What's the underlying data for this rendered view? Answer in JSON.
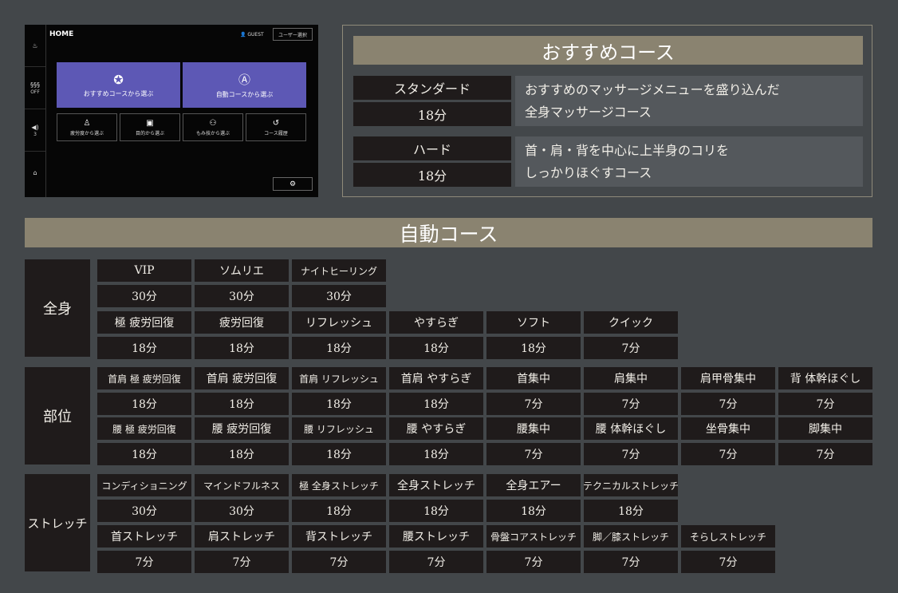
{
  "device": {
    "home_label": "HOME",
    "guest_label": "GUEST",
    "user_select_label": "ユーザー選択",
    "side": [
      {
        "icon": "massage-chair-icon",
        "glyph": "♨",
        "sub": ""
      },
      {
        "icon": "heat-icon",
        "glyph": "§§§",
        "sub": "OFF"
      },
      {
        "icon": "volume-icon",
        "glyph": "◀)",
        "sub": "3"
      },
      {
        "icon": "home-icon",
        "glyph": "⌂",
        "sub": ""
      }
    ],
    "big_buttons": [
      {
        "icon": "award-icon",
        "glyph": "✪",
        "label": "おすすめコースから選ぶ"
      },
      {
        "icon": "auto-icon",
        "glyph": "Ⓐ",
        "label": "自動コースから選ぶ"
      }
    ],
    "small_buttons": [
      {
        "icon": "body-icon",
        "glyph": "♙",
        "label": "疲労度から選ぶ"
      },
      {
        "icon": "target-icon",
        "glyph": "▣",
        "label": "目的から選ぶ"
      },
      {
        "icon": "massage-icon",
        "glyph": "⚇",
        "label": "もみ技から選ぶ"
      },
      {
        "icon": "history-icon",
        "glyph": "↺",
        "label": "コース履歴"
      }
    ],
    "settings_glyph": "⚙"
  },
  "recommended": {
    "title": "おすすめコース",
    "courses": [
      {
        "name": "スタンダード",
        "time": "18分",
        "desc1": "おすすめのマッサージメニューを盛り込んだ",
        "desc2": "全身マッサージコース"
      },
      {
        "name": "ハード",
        "time": "18分",
        "desc1": "首・肩・背を中心に上半身のコリを",
        "desc2": "しっかりほぐすコース"
      }
    ]
  },
  "auto": {
    "title": "自動コース",
    "categories": [
      {
        "name": "全身",
        "rows": [
          [
            {
              "name": "VIP",
              "time": "30分"
            },
            {
              "name": "ソムリエ",
              "time": "30分"
            },
            {
              "name": "ナイトヒーリング",
              "time": "30分"
            }
          ],
          [
            {
              "name": "極 疲労回復",
              "time": "18分"
            },
            {
              "name": "疲労回復",
              "time": "18分"
            },
            {
              "name": "リフレッシュ",
              "time": "18分"
            },
            {
              "name": "やすらぎ",
              "time": "18分"
            },
            {
              "name": "ソフト",
              "time": "18分"
            },
            {
              "name": "クイック",
              "time": "7分"
            }
          ]
        ]
      },
      {
        "name": "部位",
        "rows": [
          [
            {
              "name": "首肩 極 疲労回復",
              "time": "18分"
            },
            {
              "name": "首肩 疲労回復",
              "time": "18分"
            },
            {
              "name": "首肩 リフレッシュ",
              "time": "18分"
            },
            {
              "name": "首肩 やすらぎ",
              "time": "18分"
            },
            {
              "name": "首集中",
              "time": "7分"
            },
            {
              "name": "肩集中",
              "time": "7分"
            },
            {
              "name": "肩甲骨集中",
              "time": "7分"
            },
            {
              "name": "背 体幹ほぐし",
              "time": "7分"
            }
          ],
          [
            {
              "name": "腰 極 疲労回復",
              "time": "18分"
            },
            {
              "name": "腰 疲労回復",
              "time": "18分"
            },
            {
              "name": "腰 リフレッシュ",
              "time": "18分"
            },
            {
              "name": "腰 やすらぎ",
              "time": "18分"
            },
            {
              "name": "腰集中",
              "time": "7分"
            },
            {
              "name": "腰 体幹ほぐし",
              "time": "7分"
            },
            {
              "name": "坐骨集中",
              "time": "7分"
            },
            {
              "name": "脚集中",
              "time": "7分"
            }
          ]
        ]
      },
      {
        "name": "ストレッチ",
        "rows": [
          [
            {
              "name": "コンディショニング",
              "time": "30分"
            },
            {
              "name": "マインドフルネス",
              "time": "30分"
            },
            {
              "name": "極 全身ストレッチ",
              "time": "18分"
            },
            {
              "name": "全身ストレッチ",
              "time": "18分"
            },
            {
              "name": "全身エアー",
              "time": "18分"
            },
            {
              "name": "テクニカルストレッチ",
              "time": "18分"
            }
          ],
          [
            {
              "name": "首ストレッチ",
              "time": "7分"
            },
            {
              "name": "肩ストレッチ",
              "time": "7分"
            },
            {
              "name": "背ストレッチ",
              "time": "7分"
            },
            {
              "name": "腰ストレッチ",
              "time": "7分"
            },
            {
              "name": "骨盤コアストレッチ",
              "time": "7分"
            },
            {
              "name": "脚／膝ストレッチ",
              "time": "7分"
            },
            {
              "name": "そらしストレッチ",
              "time": "7分"
            }
          ]
        ]
      }
    ]
  }
}
